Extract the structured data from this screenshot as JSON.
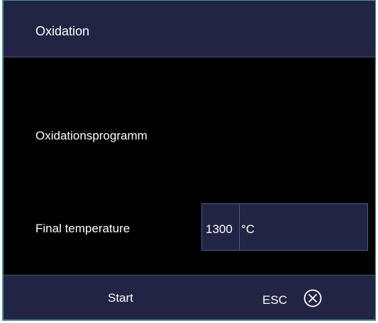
{
  "title": "Oxidation",
  "main": {
    "program_label": "Oxidationsprogramm",
    "final_temperature_label": "Final temperature",
    "final_temperature_value": "1300",
    "final_temperature_unit": "°C"
  },
  "footer": {
    "start_label": "Start",
    "esc_label": "ESC",
    "esc_icon": "circle-x-icon"
  },
  "colors": {
    "panel_background": "#222444",
    "content_background": "#000000",
    "border_accent": "#4a8f97",
    "text": "#ffffff"
  }
}
